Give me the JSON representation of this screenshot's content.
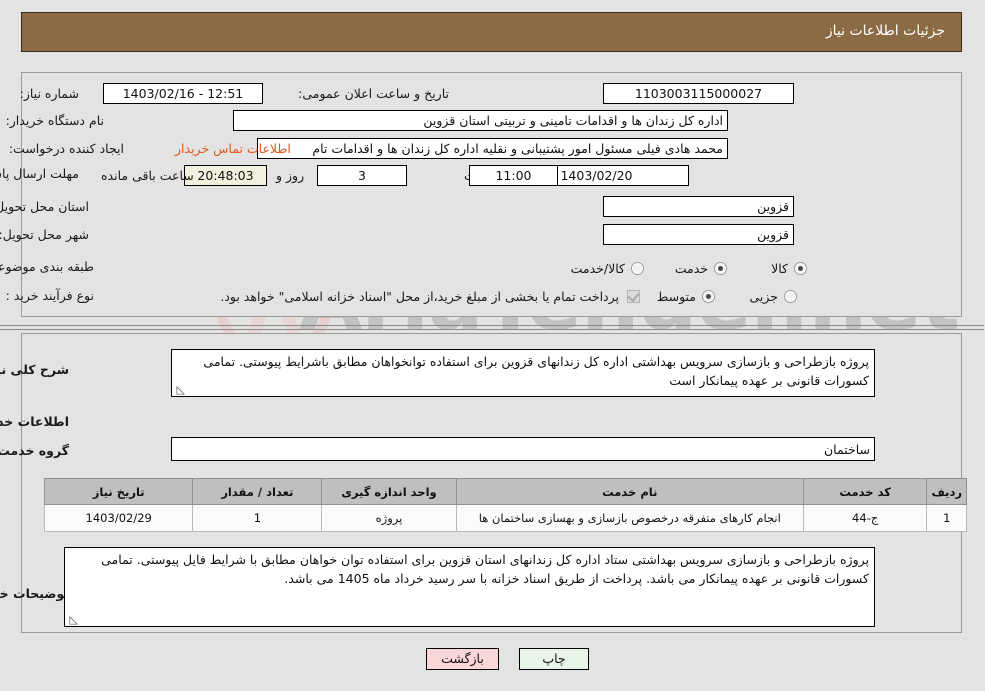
{
  "header": {
    "title": "جزئیات اطلاعات نیاز"
  },
  "form": {
    "need_number": {
      "label": "شماره نیاز:",
      "value": "1103003115000027"
    },
    "announce_datetime": {
      "label": "تاریخ و ساعت اعلان عمومی:",
      "value": "12:51 - 1403/02/16"
    },
    "buyer_org": {
      "label": "نام دستگاه خریدار:",
      "value": "اداره کل زندان ها و اقدامات تامینی و تربیتی استان قزوین"
    },
    "requester": {
      "label": "ایجاد کننده درخواست:",
      "value": "محمد هادی فیلی مسئول امور پشتیبانی و نقلیه اداره کل زندان ها و اقدامات تام"
    },
    "contact_link": "اطلاعات تماس خریدار",
    "deadline": {
      "label": "مهلت ارسال پاسخ: تا تاریخ:",
      "date": "1403/02/20",
      "hour_label": "ساعت",
      "hour": "11:00",
      "days": "3",
      "days_label": "روز و",
      "countdown": "20:48:03",
      "countdown_label": "ساعت باقی مانده"
    },
    "province": {
      "label": "استان محل تحویل:",
      "value": "قزوین"
    },
    "city": {
      "label": "شهر محل تحویل:",
      "value": "قزوین"
    },
    "category": {
      "label": "طبقه بندی موضوعی:",
      "options": [
        "کالا",
        "خدمت",
        "کالا/خدمت"
      ],
      "selected": "خدمت"
    },
    "process_type": {
      "label": "نوع فرآیند خرید :",
      "options": [
        "جزیی",
        "متوسط"
      ],
      "selected": "متوسط"
    },
    "treasury_note": {
      "checked": true,
      "text": "پرداخت تمام یا بخشی از مبلغ خرید،از محل \"اسناد خزانه اسلامی\" خواهد بود."
    }
  },
  "description": {
    "label": "شرح کلی نیاز:",
    "value": "پروژه بازطراحی و بازسازی سرویس بهداشتی اداره کل زندانهای قزوین برای استفاده توانخواهان مطابق باشرایط پیوستی. تمامی کسورات قانونی بر عهده پیمانکار است"
  },
  "services_section": {
    "title": "اطلاعات خدمات مورد نیاز",
    "service_group": {
      "label": "گروه خدمت:",
      "value": "ساختمان"
    },
    "table": {
      "columns": [
        "ردیف",
        "کد خدمت",
        "نام خدمت",
        "واحد اندازه گیری",
        "تعداد / مقدار",
        "تاریخ نیاز"
      ],
      "rows": [
        {
          "row": "1",
          "code": "ج-44",
          "name": "انجام کارهای متفرقه درخصوص بازسازی و بهسازی ساختمان ها",
          "unit": "پروژه",
          "qty": "1",
          "need_date": "1403/02/29"
        }
      ]
    }
  },
  "buyer_notes": {
    "label": "توضیحات خریدار:",
    "value": "پروژه بازطراحی و بازسازی سرویس بهداشتی ستاد اداره کل زندانهای استان قزوین برای استفاده توان خواهان مطابق با شرایط فایل پیوستی. تمامی کسورات قانونی بر عهده پیمانکار می باشد. پرداخت از طریق اسناد خزانه با سر رسید خرداد ماه 1405 می باشد."
  },
  "footer": {
    "print_label": "چاپ",
    "back_label": "بازگشت"
  },
  "watermark": {
    "text": "AriaTender.net"
  },
  "colors": {
    "header_bg": "#8b6b43",
    "link": "#e2571e",
    "print_btn": "#e6f5e6",
    "back_btn": "#fbd6d6",
    "table_header": "#bfbfbf"
  }
}
